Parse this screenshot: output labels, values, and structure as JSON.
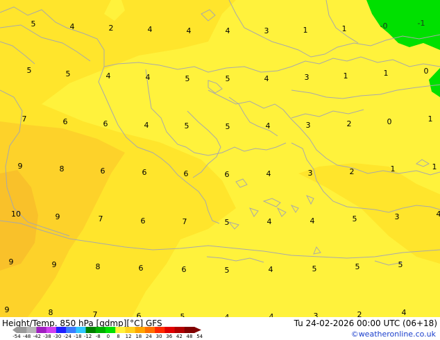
{
  "map": {
    "title_model": "Height/Temp. 850 hPa [gdmp][°C]",
    "model_name": "GFS",
    "valid_time": "Tu 24-02-2026 00:00 UTC (06+18)",
    "credit": "©weatheronline.co.uk",
    "colors": {
      "warm_0": "#fff23c",
      "warm_4": "#ffe52c",
      "warm_8": "#fdd22a",
      "warm_10": "#f9c12a",
      "cold_green": "#00e000",
      "border": "#a9a9a9"
    },
    "values": [
      "5",
      "4",
      "2",
      "4",
      "4",
      "4",
      "3",
      "1",
      "1",
      "-0",
      "-1",
      "5",
      "5",
      "4",
      "4",
      "5",
      "5",
      "4",
      "3",
      "1",
      "1",
      "0",
      "7",
      "6",
      "6",
      "4",
      "5",
      "5",
      "4",
      "3",
      "2",
      "0",
      "1",
      "9",
      "8",
      "6",
      "6",
      "6",
      "6",
      "4",
      "3",
      "2",
      "1",
      "1",
      "10",
      "9",
      "7",
      "6",
      "7",
      "5",
      "4",
      "4",
      "5",
      "3",
      "4",
      "9",
      "9",
      "8",
      "6",
      "6",
      "5",
      "4",
      "5",
      "5",
      "5",
      "9",
      "8",
      "7",
      "6",
      "5",
      "4",
      "4",
      "3",
      "2",
      "4"
    ],
    "colorbar": {
      "ticks": [
        "-54",
        "-48",
        "-42",
        "-38",
        "-30",
        "-24",
        "-18",
        "-12",
        "-8",
        "0",
        "8",
        "12",
        "18",
        "24",
        "30",
        "36",
        "42",
        "48",
        "54"
      ],
      "colors": [
        "#9a9a9a",
        "#b7b7b7",
        "#a020c0",
        "#d040f0",
        "#2020ff",
        "#3a7dff",
        "#2fc7ff",
        "#008000",
        "#00b000",
        "#00e000",
        "#fff23c",
        "#ffd21f",
        "#ffa500",
        "#ff7000",
        "#ff2a00",
        "#e00000",
        "#b00000",
        "#800000"
      ]
    }
  }
}
